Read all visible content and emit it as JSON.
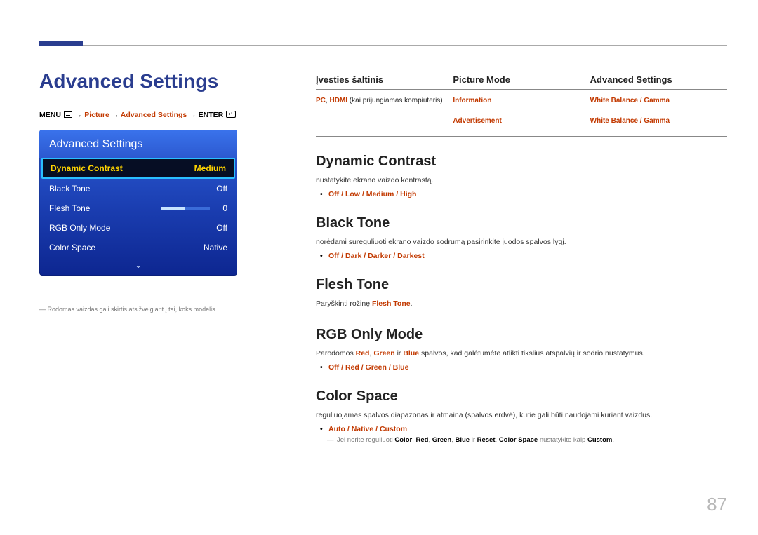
{
  "page": {
    "title": "Advanced Settings",
    "number": "87"
  },
  "breadcrumb": {
    "menu": "MENU",
    "arrow": "→",
    "picture": "Picture",
    "adv": "Advanced Settings",
    "enter": "ENTER"
  },
  "osd": {
    "title": "Advanced Settings",
    "rows": [
      {
        "label": "Dynamic Contrast",
        "value": "Medium",
        "selected": true
      },
      {
        "label": "Black Tone",
        "value": "Off"
      },
      {
        "label": "Flesh Tone",
        "value": "0",
        "slider": true
      },
      {
        "label": "RGB Only Mode",
        "value": "Off"
      },
      {
        "label": "Color Space",
        "value": "Native"
      }
    ],
    "note": "Rodomas vaizdas gali skirtis atsižvelgiant į tai, koks modelis."
  },
  "source_table": {
    "headers": [
      "Įvesties šaltinis",
      "Picture Mode",
      "Advanced Settings"
    ],
    "rows": [
      {
        "src_hl": "PC",
        "src_sep1": ", ",
        "src_hl2": "HDMI",
        "src_tail": " (kai prijungiamas kompiuteris)",
        "mode": "Information",
        "adv_a": "White Balance",
        "adv_sep": " / ",
        "adv_b": "Gamma"
      },
      {
        "src_hl": "",
        "src_sep1": "",
        "src_hl2": "",
        "src_tail": "",
        "mode": "Advertisement",
        "adv_a": "White Balance",
        "adv_sep": " / ",
        "adv_b": "Gamma"
      }
    ]
  },
  "sections": {
    "dynamic": {
      "title": "Dynamic Contrast",
      "desc": "nustatykite ekrano vaizdo kontrastą.",
      "opts": [
        "Off",
        "Low",
        "Medium",
        "High"
      ]
    },
    "black": {
      "title": "Black Tone",
      "desc": "norėdami sureguliuoti ekrano vaizdo sodrumą pasirinkite juodos spalvos lygį.",
      "opts": [
        "Off",
        "Dark",
        "Darker",
        "Darkest"
      ]
    },
    "flesh": {
      "title": "Flesh Tone",
      "desc_pre": "Paryškinti rožinę ",
      "desc_hl": "Flesh Tone",
      "desc_post": "."
    },
    "rgb": {
      "title": "RGB Only Mode",
      "desc_pre": "Parodomos ",
      "r": "Red",
      "c1": ", ",
      "g": "Green",
      "c2": " ir ",
      "b": "Blue",
      "desc_post": " spalvos, kad galėtumėte atlikti tikslius atspalvių ir sodrio nustatymus.",
      "opts": [
        "Off",
        "Red",
        "Green",
        "Blue"
      ]
    },
    "cspace": {
      "title": "Color Space",
      "desc": "reguliuojamas spalvos diapazonas ir atmaina (spalvos erdvė), kurie gali būti naudojami kuriant vaizdus.",
      "opts": [
        "Auto",
        "Native",
        "Custom"
      ],
      "note_pre": "Jei norite reguliuoti ",
      "n1": "Color",
      "s1": ", ",
      "n2": "Red",
      "s2": ", ",
      "n3": "Green",
      "s3": ", ",
      "n4": "Blue",
      "s4": " ir ",
      "n5": "Reset",
      "s5": ", ",
      "n6": "Color Space",
      "note_mid": " nustatykite kaip ",
      "n7": "Custom",
      "note_post": "."
    }
  }
}
